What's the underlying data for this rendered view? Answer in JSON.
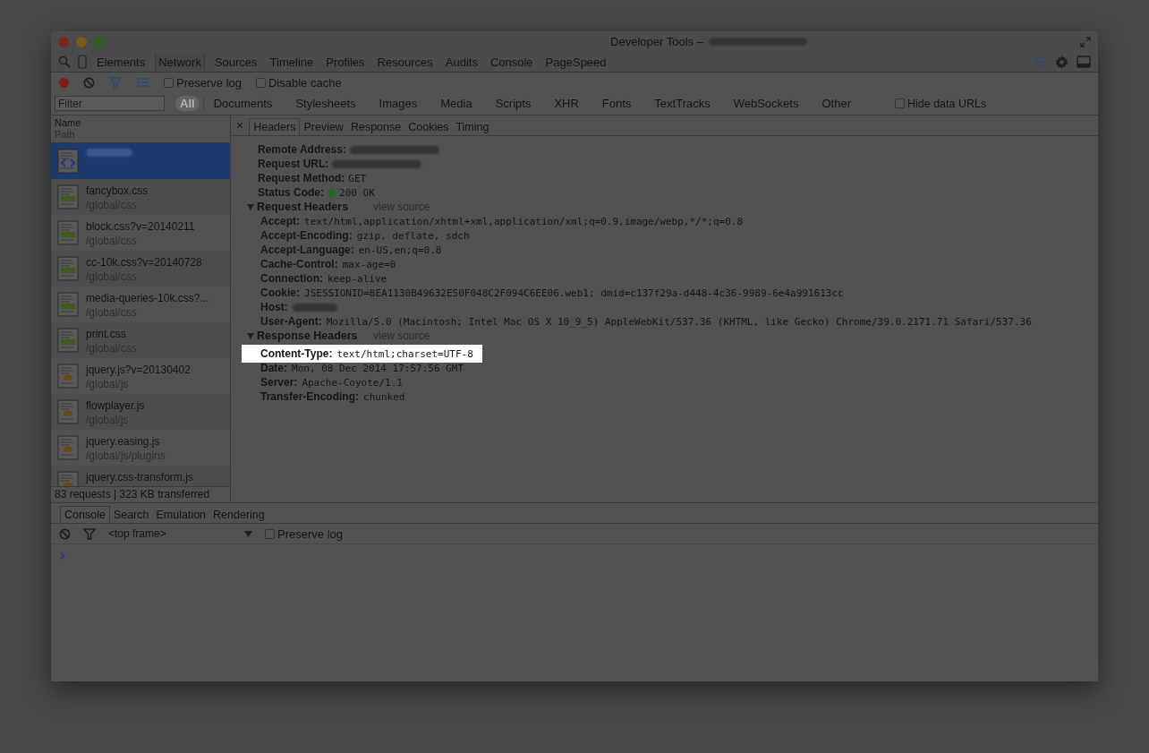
{
  "window": {
    "title": "Developer Tools –"
  },
  "panel_tabs": [
    {
      "label": "Elements",
      "selected": false
    },
    {
      "label": "Network",
      "selected": true
    },
    {
      "label": "Sources",
      "selected": false
    },
    {
      "label": "Timeline",
      "selected": false
    },
    {
      "label": "Profiles",
      "selected": false
    },
    {
      "label": "Resources",
      "selected": false
    },
    {
      "label": "Audits",
      "selected": false
    },
    {
      "label": "Console",
      "selected": false
    },
    {
      "label": "PageSpeed",
      "selected": false
    }
  ],
  "toolbar": {
    "recording": true,
    "preserve_log": {
      "label": "Preserve log",
      "checked": false
    },
    "disable_cache": {
      "label": "Disable cache",
      "checked": false
    }
  },
  "filter_bar": {
    "placeholder": "Filter",
    "types": [
      {
        "label": "All",
        "selected": true
      },
      {
        "label": "Documents",
        "selected": false
      },
      {
        "label": "Stylesheets",
        "selected": false
      },
      {
        "label": "Images",
        "selected": false
      },
      {
        "label": "Media",
        "selected": false
      },
      {
        "label": "Scripts",
        "selected": false
      },
      {
        "label": "XHR",
        "selected": false
      },
      {
        "label": "Fonts",
        "selected": false
      },
      {
        "label": "TextTracks",
        "selected": false
      },
      {
        "label": "WebSockets",
        "selected": false
      },
      {
        "label": "Other",
        "selected": false
      }
    ],
    "hide_data_urls": {
      "label": "Hide data URLs",
      "checked": false
    }
  },
  "requests": {
    "columns": [
      "Name",
      "Path"
    ],
    "rows": [
      {
        "kind": "html",
        "selected": true
      },
      {
        "kind": "css",
        "name": "fancybox.css",
        "path": "/global/css",
        "selected": false
      },
      {
        "kind": "css",
        "name": "block.css?v=20140211",
        "path": "/global/css",
        "selected": false
      },
      {
        "kind": "css",
        "name": "cc-10k.css?v=20140728",
        "path": "/global/css",
        "selected": false
      },
      {
        "kind": "css",
        "name": "media-queries-10k.css?...",
        "path": "/global/css",
        "selected": false
      },
      {
        "kind": "css",
        "name": "print.css",
        "path": "/global/css",
        "selected": false
      },
      {
        "kind": "js",
        "name": "jquery.js?v=20130402",
        "path": "/global/js",
        "selected": false
      },
      {
        "kind": "js",
        "name": "flowplayer.js",
        "path": "/global/js",
        "selected": false
      },
      {
        "kind": "js",
        "name": "jquery.easing.js",
        "path": "/global/js/plugins",
        "selected": false
      },
      {
        "kind": "js",
        "name": "jquery.css-transform.js",
        "selected": false
      }
    ],
    "status": "83 requests | 323 KB transferred"
  },
  "detail_close": "×",
  "detail_tabs": [
    {
      "label": "Headers",
      "selected": true
    },
    {
      "label": "Preview",
      "selected": false
    },
    {
      "label": "Response",
      "selected": false
    },
    {
      "label": "Cookies",
      "selected": false
    },
    {
      "label": "Timing",
      "selected": false
    }
  ],
  "general": [
    {
      "name": "Remote Address:",
      "kind": "hidden"
    },
    {
      "name": "Request URL:",
      "kind": "hidden"
    },
    {
      "name": "Request Method:",
      "value": "GET",
      "kind": "text"
    },
    {
      "name": "Status Code:",
      "value": "200 OK",
      "kind": "status"
    }
  ],
  "sections": [
    {
      "title": "Request Headers",
      "view_source": "view source",
      "expanded": true,
      "headers": [
        {
          "name": "Accept:",
          "value": "text/html,application/xhtml+xml,application/xml;q=0.9,image/webp,*/*;q=0.8",
          "highlighted": false
        },
        {
          "name": "Accept-Encoding:",
          "value": "gzip, deflate, sdch",
          "highlighted": false
        },
        {
          "name": "Accept-Language:",
          "value": "en-US,en;q=0.8",
          "highlighted": false
        },
        {
          "name": "Cache-Control:",
          "value": "max-age=0",
          "highlighted": false
        },
        {
          "name": "Connection:",
          "value": "keep-alive",
          "highlighted": false
        },
        {
          "name": "Cookie:",
          "value": "JSESSIONID=8EA1130B49632E50F048C2F094C6EE06.web1; dmid=c137f29a-d448-4c36-9989-6e4a991613cc",
          "highlighted": false
        },
        {
          "name": "Host:",
          "highlighted": false
        },
        {
          "name": "User-Agent:",
          "value": "Mozilla/5.0 (Macintosh; Intel Mac OS X 10_9_5) AppleWebKit/537.36 (KHTML, like Gecko) Chrome/39.0.2171.71 Safari/537.36",
          "highlighted": false
        }
      ]
    },
    {
      "title": "Response Headers",
      "view_source": "view source",
      "expanded": true,
      "headers": [
        {
          "name": "Content-Type:",
          "value": "text/html;charset=UTF-8",
          "highlighted": true
        },
        {
          "name": "Date:",
          "value": "Mon, 08 Dec 2014 17:57:56 GMT",
          "highlighted": false
        },
        {
          "name": "Server:",
          "value": "Apache-Coyote/1.1",
          "highlighted": false
        },
        {
          "name": "Transfer-Encoding:",
          "value": "chunked",
          "highlighted": false
        }
      ]
    }
  ],
  "drawer": {
    "tabs": [
      {
        "label": "Console",
        "selected": true
      },
      {
        "label": "Search",
        "selected": false
      },
      {
        "label": "Emulation",
        "selected": false
      },
      {
        "label": "Rendering",
        "selected": false
      }
    ],
    "context": "<top frame>",
    "preserve_log": {
      "label": "Preserve log",
      "checked": false
    }
  }
}
